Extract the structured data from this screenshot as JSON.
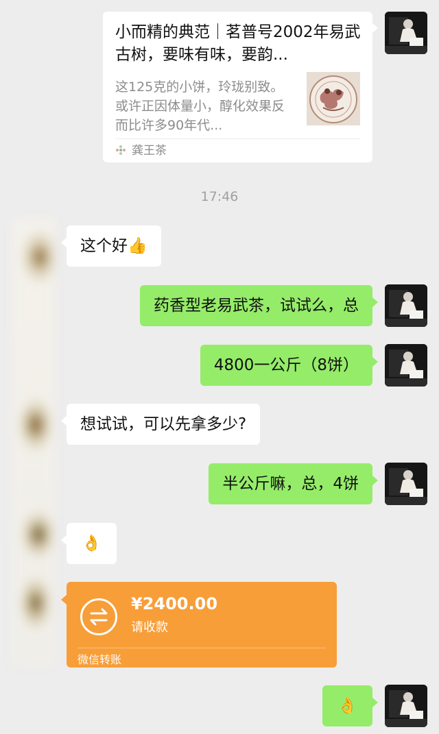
{
  "link_card": {
    "title": "小而精的典范｜茗普号2002年易武古树，要味有味，要韵...",
    "description": "这125克的小饼，玲珑别致。或许正因体量小，醇化效果反而比许多90年代...",
    "source": "龚王茶",
    "thumbnail_icon": "tea-cake-wrapper-image"
  },
  "timestamp": "17:46",
  "messages": [
    {
      "side": "left",
      "text": "这个好👍"
    },
    {
      "side": "right",
      "text": "药香型老易武茶，试试么，总"
    },
    {
      "side": "right",
      "text": "4800一公斤（8饼）"
    },
    {
      "side": "left",
      "text": "想试试，可以先拿多少?"
    },
    {
      "side": "right",
      "text": "半公斤嘛，总，4饼"
    },
    {
      "side": "left",
      "text": "👌"
    },
    {
      "side": "right",
      "text": "👌"
    }
  ],
  "transfer": {
    "amount": "¥2400.00",
    "status": "请收款",
    "footer": "微信转账",
    "icon": "transfer-arrows-icon",
    "color": "#f79e39"
  },
  "colors": {
    "background": "#ededed",
    "sent_bubble": "#95ec69",
    "received_bubble": "#ffffff"
  }
}
